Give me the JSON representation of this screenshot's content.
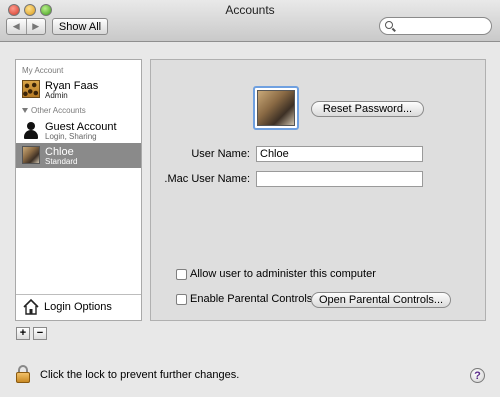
{
  "window": {
    "title": "Accounts"
  },
  "toolbar": {
    "back_glyph": "◀",
    "forward_glyph": "▶",
    "show_all": "Show All",
    "search_value": ""
  },
  "sidebar": {
    "my_account_header": "My Account",
    "other_accounts_header": "Other Accounts",
    "accounts": [
      {
        "name": "Ryan Faas",
        "role": "Admin",
        "icon": "leopard-avatar-icon"
      },
      {
        "name": "Guest Account",
        "role": "Login, Sharing",
        "icon": "guest-user-icon"
      },
      {
        "name": "Chloe",
        "role": "Standard",
        "icon": "cat-avatar-icon",
        "selected": true
      }
    ],
    "login_options": "Login Options",
    "add_label": "+",
    "remove_label": "−"
  },
  "main": {
    "reset_password": "Reset Password...",
    "user_name_label": "User Name:",
    "user_name_value": "Chloe",
    "mac_user_name_label": ".Mac User Name:",
    "mac_user_name_value": "",
    "allow_admin_label": "Allow user to administer this computer",
    "allow_admin_checked": false,
    "parental_controls_label": "Enable Parental Controls",
    "parental_controls_checked": false,
    "open_parental_controls": "Open Parental Controls..."
  },
  "footer": {
    "lock_text": "Click the lock to prevent further changes.",
    "help_label": "?"
  },
  "colors": {
    "selection": "#8a8a8a",
    "focus_ring": "#6fa0e0"
  }
}
